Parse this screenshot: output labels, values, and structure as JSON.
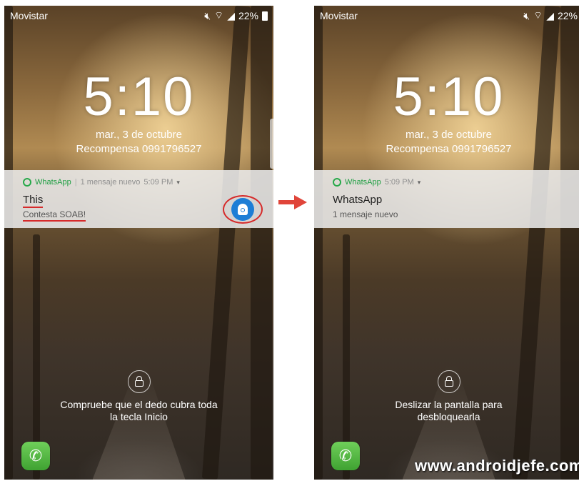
{
  "left_screen": {
    "carrier": "Movistar",
    "battery": "22%",
    "time": "5:10",
    "date": "mar., 3 de octubre",
    "owner_info": "Recompensa 0991796527",
    "notification": {
      "app_name": "WhatsApp",
      "separator": "|",
      "meta": "1 mensaje nuevo",
      "time": "5:09 PM",
      "title": "This",
      "body": "Contesta SOAB!"
    },
    "unlock_hint_line1": "Compruebe que el dedo cubra toda",
    "unlock_hint_line2": "la tecla Inicio"
  },
  "right_screen": {
    "carrier": "Movistar",
    "battery": "22%",
    "time": "5:10",
    "date": "mar., 3 de octubre",
    "owner_info": "Recompensa 0991796527",
    "notification": {
      "app_name": "WhatsApp",
      "time": "5:09 PM",
      "title": "WhatsApp",
      "body": "1 mensaje nuevo"
    },
    "unlock_hint_line1": "Deslizar la pantalla para",
    "unlock_hint_line2": "desbloquearla"
  },
  "watermark": "www.androidjefe.com",
  "colors": {
    "annotation_red": "#d62a2a",
    "whatsapp_green": "#1e9e42",
    "android_blue": "#1d7ed6"
  }
}
